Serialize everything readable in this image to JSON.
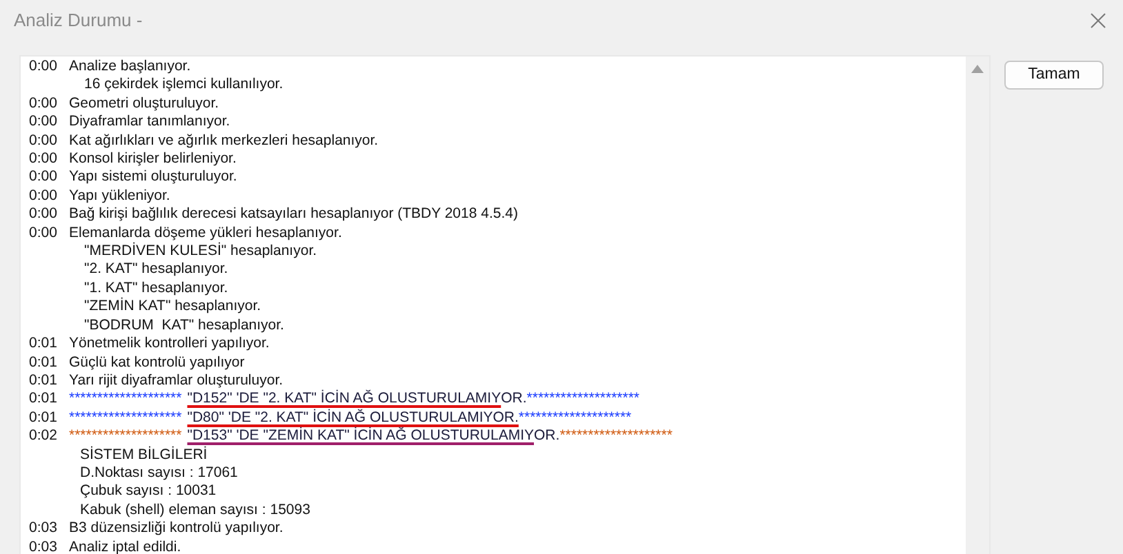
{
  "window": {
    "title": "Analiz Durumu -"
  },
  "log": [
    {
      "time": "0:00",
      "text": "Analize başlanıyor.",
      "children": [
        {
          "text": "16 çekirdek işlemci kullanılıyor."
        }
      ]
    },
    {
      "time": "0:00",
      "text": "Geometri oluşturuluyor."
    },
    {
      "time": "0:00",
      "text": "Diyaframlar tanımlanıyor."
    },
    {
      "time": "0:00",
      "text": "Kat ağırlıkları ve ağırlık merkezleri hesaplanıyor."
    },
    {
      "time": "0:00",
      "text": "Konsol kirişler belirleniyor."
    },
    {
      "time": "0:00",
      "text": "Yapı sistemi oluşturuluyor."
    },
    {
      "time": "0:00",
      "text": "Yapı yükleniyor."
    },
    {
      "time": "0:00",
      "text": "Bağ kirişi bağlılık derecesi katsayıları hesaplanıyor (TBDY 2018 4.5.4)"
    },
    {
      "time": "0:00",
      "text": "Elemanlarda döşeme yükleri hesaplanıyor.",
      "children": [
        {
          "text": "\"MERDİVEN KULESİ\" hesaplanıyor."
        },
        {
          "text": "\"2. KAT\" hesaplanıyor."
        },
        {
          "text": "\"1. KAT\" hesaplanıyor."
        },
        {
          "text": "\"ZEMİN KAT\" hesaplanıyor."
        },
        {
          "text": "\"BODRUM  KAT\" hesaplanıyor."
        }
      ]
    },
    {
      "time": "0:01",
      "text": "Yönetmelik kontrolleri yapılıyor."
    },
    {
      "time": "0:01",
      "text": "Güçlü kat kontrolü yapılıyor"
    },
    {
      "time": "0:01",
      "text": "Yarı rijit diyaframlar oluşturuluyor."
    },
    {
      "time": "0:01",
      "kind": "error",
      "color": "#1a3cff",
      "underline": {
        "color": "#e01010"
      },
      "stars_left": "********************",
      "marked": "\"D152\" 'DE \"2. KAT\" İCİN AĞ OLUSTURULAMIY",
      "rest": "OR.",
      "stars_right": "********************"
    },
    {
      "time": "0:01",
      "kind": "error",
      "color": "#1a3cff",
      "underline": {
        "color": "#e01010"
      },
      "stars_left": "********************",
      "marked": "\"D80\" 'DE \"2. KAT\" İCİN AĞ OLUSTURULAMIYOR.",
      "stars_right": "********************"
    },
    {
      "time": "0:02",
      "kind": "error",
      "color": "#d05a10",
      "underline": {
        "color": "#a0206a"
      },
      "stars_left": "********************",
      "marked": "\"D153\" 'DE \"ZEMİN KAT\" İCİN AĞ OLUSTURULAMIY",
      "rest": "OR.",
      "stars_right": "********************",
      "children": [
        {
          "text": "SİSTEM BİLGİLERİ"
        },
        {
          "text": "D.Noktası sayısı : 17061"
        },
        {
          "text": "Çubuk sayısı : 10031"
        },
        {
          "text": "Kabuk (shell) eleman sayısı : 15093"
        }
      ]
    },
    {
      "time": "0:03",
      "text": "B3 düzensizliği kontrolü yapılıyor."
    },
    {
      "time": "0:03",
      "text": "Analiz iptal edildi."
    }
  ],
  "buttons": [
    {
      "label": "Tamam"
    }
  ]
}
